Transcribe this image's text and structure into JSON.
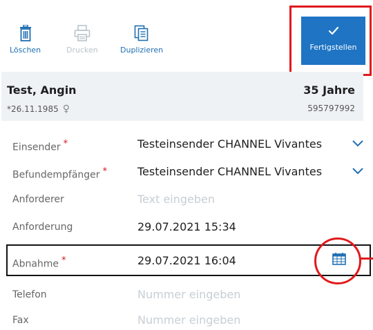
{
  "toolbar": {
    "delete_label": "Löschen",
    "print_label": "Drucken",
    "duplicate_label": "Duplizieren",
    "finish_label": "Fertigstellen"
  },
  "patient": {
    "name": "Test, Angin",
    "age": "35 Jahre",
    "dob": "*26.11.1985",
    "gender_symbol": "♀",
    "id": "595797992"
  },
  "form": {
    "rows": [
      {
        "label": "Einsender",
        "required": "*",
        "value": "Testeinsender CHANNEL Vivantes"
      },
      {
        "label": "Befundempfänger",
        "required": "*",
        "value": "Testeinsender CHANNEL Vivantes"
      },
      {
        "label": "Anforderer",
        "placeholder": "Text eingeben"
      },
      {
        "label": "Anforderung",
        "value": "29.07.2021 15:34"
      },
      {
        "label": "Abnahme",
        "required": "*",
        "value": "29.07.2021 16:04"
      },
      {
        "label": "Telefon",
        "placeholder": "Nummer eingeben"
      },
      {
        "label": "Fax",
        "placeholder": "Nummer eingeben"
      }
    ]
  },
  "icons": {
    "delete": "trash-icon",
    "print": "printer-icon",
    "duplicate": "duplicate-icon",
    "finish": "checkmark-icon",
    "dropdown": "chevron-down-icon",
    "calendar": "calendar-icon"
  },
  "colors": {
    "accent": "#1f74c4",
    "required": "#d7141a",
    "annotation": "#e0191c"
  }
}
